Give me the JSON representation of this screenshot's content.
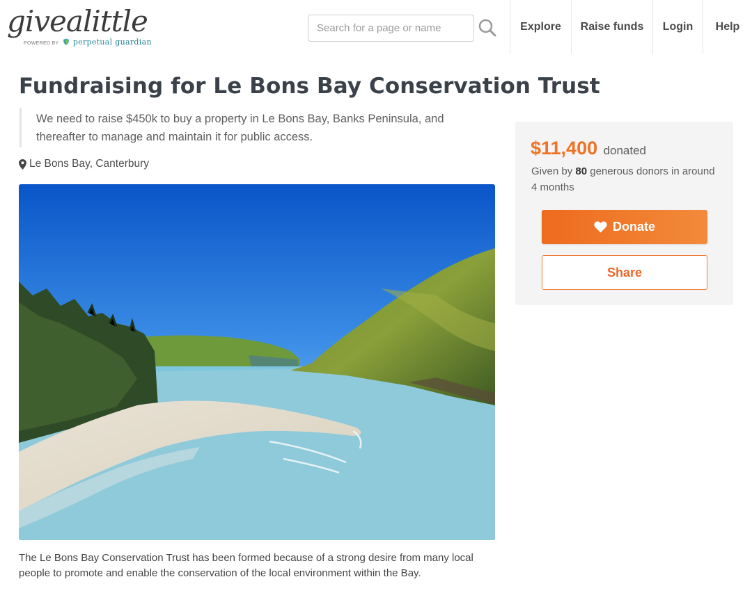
{
  "header": {
    "logo_text": "givealittle",
    "logo_powered": "POWERED BY",
    "logo_brand_a": "perpetual",
    "logo_brand_b": "guardian",
    "search_placeholder": "Search for a page or name",
    "nav": [
      "Explore",
      "Raise funds",
      "Login",
      "Help"
    ],
    "icons": {
      "search": "search-icon"
    }
  },
  "page": {
    "title": "Fundraising for Le Bons Bay Conservation Trust",
    "blurb": "We need to raise $450k to buy a property in Le Bons Bay, Banks Peninsula, and thereafter to manage and maintain it for public access.",
    "location": "Le Bons Bay, Canterbury",
    "description": "The Le Bons Bay Conservation Trust has been formed because of a strong desire from many local people to promote and enable the conservation of the local environment within the Bay."
  },
  "donation": {
    "amount": "$11,400",
    "amount_suffix": "donated",
    "given_prefix": "Given by",
    "donor_count": "80",
    "given_suffix": "generous donors in around 4 months",
    "donate_label": "Donate",
    "share_label": "Share"
  },
  "colors": {
    "accent": "#ef7225",
    "title": "#3b4149",
    "card_bg": "#f4f4f5"
  }
}
